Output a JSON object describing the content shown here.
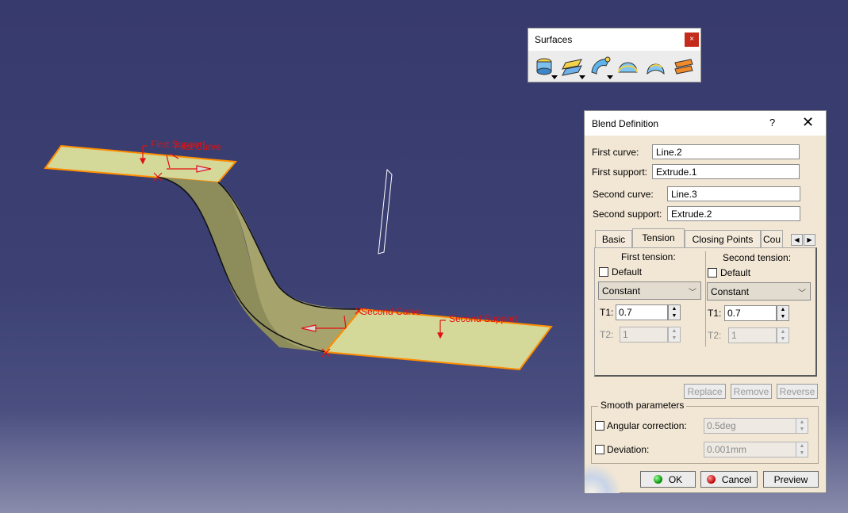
{
  "viewport": {
    "labels": {
      "first_support": "First Support",
      "first_curve": "First Curve",
      "second_curve": "Second Curve",
      "second_support": "Second Support"
    },
    "colors": {
      "surface": "#d4d99a",
      "blend": "#8c8a5a",
      "edge": "#ff8c00",
      "label": "#e31010"
    }
  },
  "surfaces_toolbar": {
    "title": "Surfaces",
    "close_glyph": "×",
    "icons": [
      "extrude-icon",
      "offset-icon",
      "sweep-icon",
      "fill-icon",
      "loft-icon",
      "blend-icon"
    ]
  },
  "blend_dialog": {
    "title": "Blend Definition",
    "help_glyph": "?",
    "close_glyph": "✕",
    "first_curve_label": "First curve:",
    "first_curve_value": "Line.2",
    "first_support_label": "First support:",
    "first_support_value": "Extrude.1",
    "second_curve_label": "Second curve:",
    "second_curve_value": "Line.3",
    "second_support_label": "Second support:",
    "second_support_value": "Extrude.2",
    "tabs": [
      {
        "label": "Basic",
        "active": false
      },
      {
        "label": "Tension",
        "active": true
      },
      {
        "label": "Closing Points",
        "active": false
      },
      {
        "label": "Cou",
        "active": false
      }
    ],
    "tension": {
      "first": {
        "heading": "First tension:",
        "default_label": "Default",
        "default_checked": false,
        "type": "Constant",
        "t1_label": "T1:",
        "t1_value": "0.7",
        "t2_label": "T2:",
        "t2_value": "1"
      },
      "second": {
        "heading": "Second tension:",
        "default_label": "Default",
        "default_checked": false,
        "type": "Constant",
        "t1_label": "T1:",
        "t1_value": "0.7",
        "t2_label": "T2:",
        "t2_value": "1"
      }
    },
    "list_buttons": {
      "replace": "Replace",
      "remove": "Remove",
      "reverse": "Reverse"
    },
    "smooth": {
      "legend": "Smooth parameters",
      "angular_label": "Angular correction:",
      "angular_value": "0.5deg",
      "deviation_label": "Deviation:",
      "deviation_value": "0.001mm"
    },
    "buttons": {
      "ok": "OK",
      "cancel": "Cancel",
      "preview": "Preview"
    }
  }
}
